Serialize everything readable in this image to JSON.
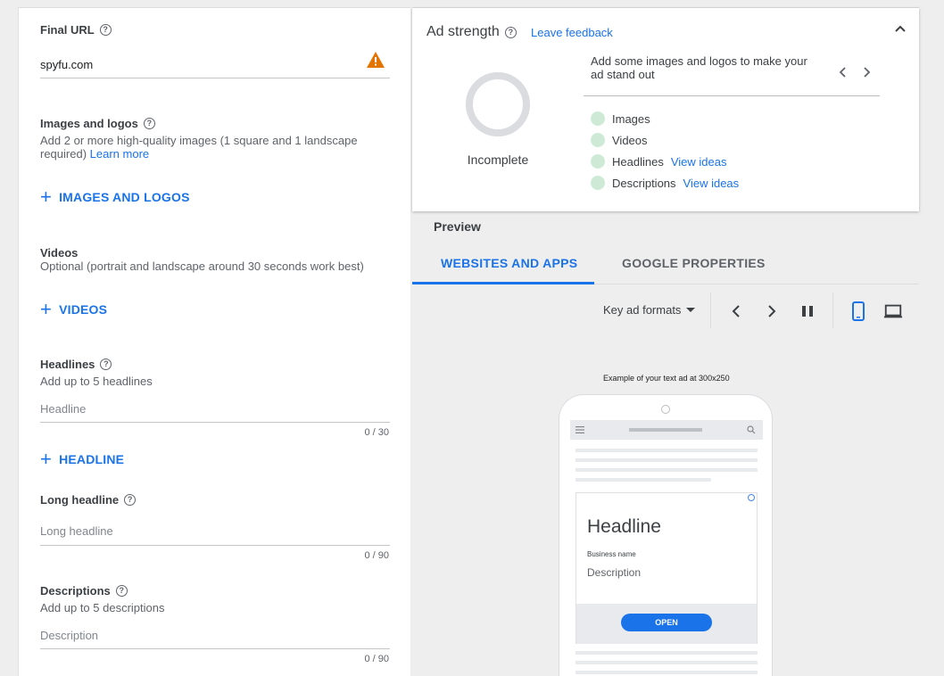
{
  "form": {
    "final_url": {
      "label": "Final URL",
      "value": "spyfu.com"
    },
    "images_logos": {
      "label": "Images and logos",
      "help_text": "Add 2 or more high-quality images (1 square and 1 landscape required)",
      "learn_more": "Learn more",
      "add_button": "IMAGES AND LOGOS"
    },
    "videos": {
      "label": "Videos",
      "help_text": "Optional (portrait and landscape around 30 seconds work best)",
      "add_button": "VIDEOS"
    },
    "headlines": {
      "label": "Headlines",
      "help_text": "Add up to 5 headlines",
      "placeholder": "Headline",
      "counter": "0 / 30",
      "add_button": "HEADLINE"
    },
    "long_headline": {
      "label": "Long headline",
      "placeholder": "Long headline",
      "counter": "0 / 90"
    },
    "descriptions": {
      "label": "Descriptions",
      "help_text": "Add up to 5 descriptions",
      "placeholder": "Description",
      "counter": "0 / 90"
    }
  },
  "ad_strength": {
    "title": "Ad strength",
    "feedback_link": "Leave feedback",
    "status": "Incomplete",
    "tip": "Add some images and logos to make your ad stand out",
    "checklist": [
      {
        "label": "Images",
        "link": ""
      },
      {
        "label": "Videos",
        "link": ""
      },
      {
        "label": "Headlines",
        "link": "View ideas"
      },
      {
        "label": "Descriptions",
        "link": "View ideas"
      }
    ]
  },
  "preview": {
    "title": "Preview",
    "tabs": [
      "WEBSITES AND APPS",
      "GOOGLE PROPERTIES"
    ],
    "active_tab": 0,
    "format_select": "Key ad formats",
    "example_caption": "Example of your text ad at 300x250",
    "ad": {
      "headline": "Headline",
      "business_name": "Business name",
      "description": "Description",
      "cta": "OPEN"
    }
  },
  "colors": {
    "accent": "#1a73e8",
    "warning": "#e37400",
    "check_dot": "#ceead6"
  },
  "icons": [
    "help-icon",
    "warning-icon",
    "plus-icon",
    "chevron-up-icon",
    "chevron-left-icon",
    "chevron-right-icon",
    "pause-icon",
    "mobile-icon",
    "laptop-icon",
    "menu-icon",
    "search-icon",
    "info-icon"
  ]
}
